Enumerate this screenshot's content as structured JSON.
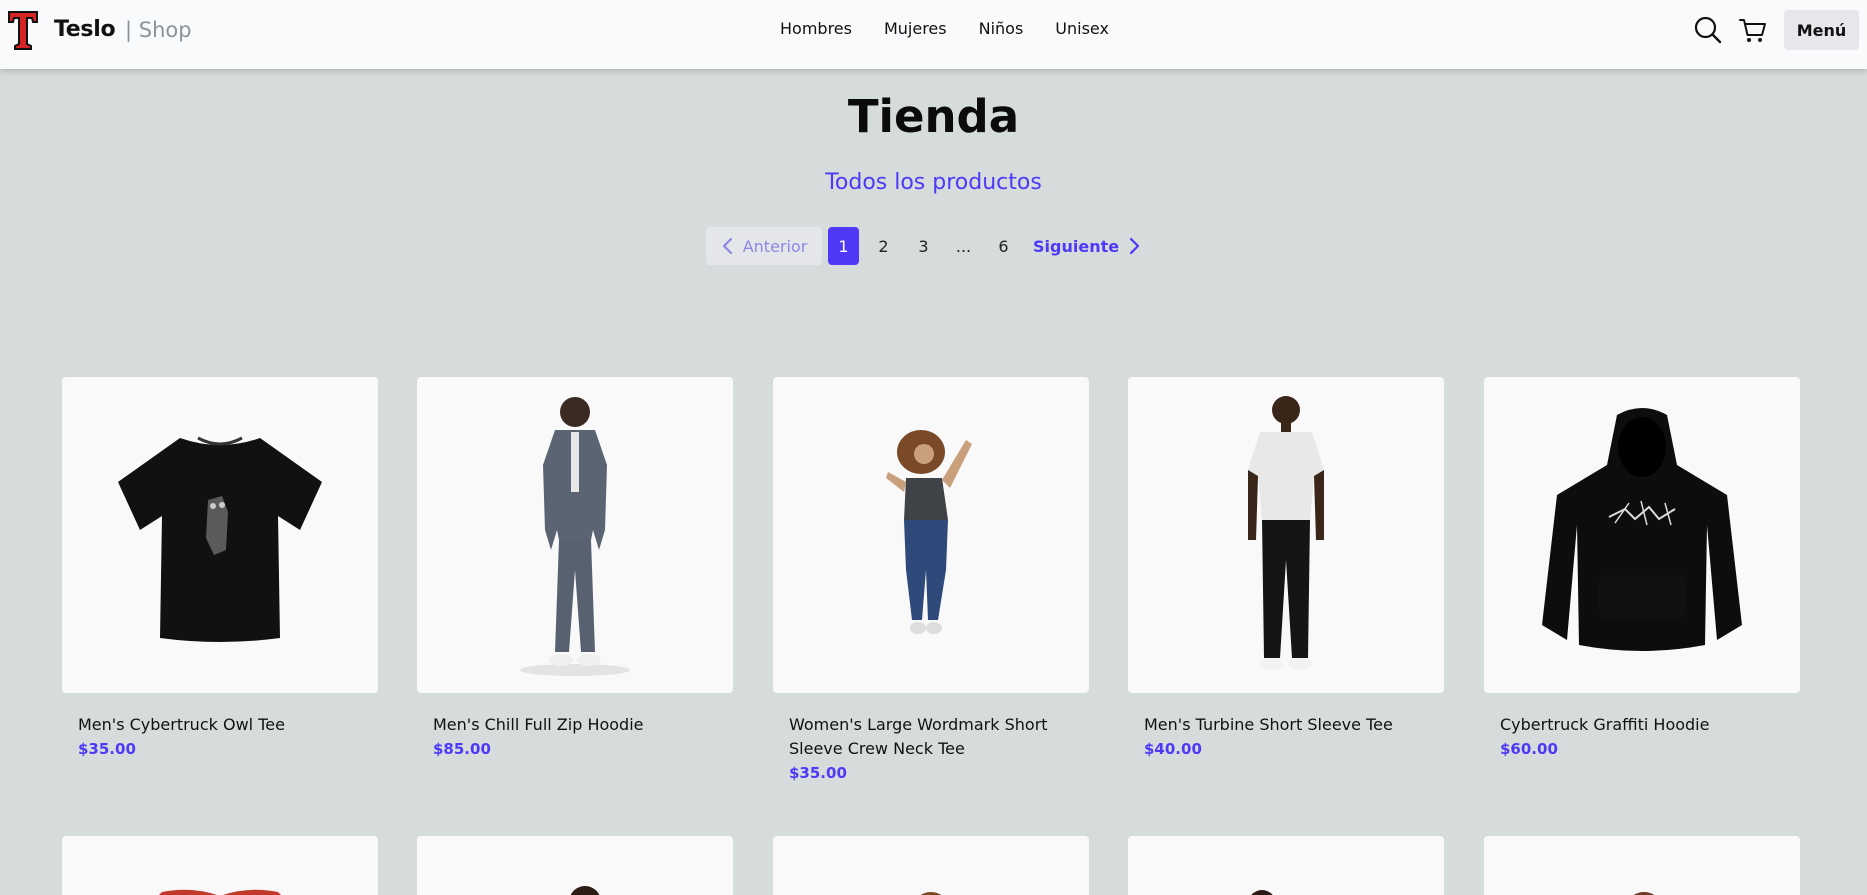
{
  "header": {
    "logo_icon": "teslo-t-logo-icon",
    "brand": "Teslo",
    "brand_suffix": "| Shop",
    "nav": [
      "Hombres",
      "Mujeres",
      "Niños",
      "Unisex"
    ],
    "search_icon": "search-icon",
    "cart_icon": "cart-icon",
    "menu_label": "Menú"
  },
  "page": {
    "title": "Tienda",
    "subtitle": "Todos los productos"
  },
  "pagination": {
    "prev_label": "Anterior",
    "pages": [
      "1",
      "2",
      "3",
      "...",
      "6"
    ],
    "current": "1",
    "next_label": "Siguiente"
  },
  "products": [
    {
      "title": "Men's Cybertruck Owl Tee",
      "price": "$35.00",
      "image": "black-tshirt"
    },
    {
      "title": "Men's Chill Full Zip Hoodie",
      "price": "$85.00",
      "image": "man-gray-hoodie"
    },
    {
      "title": "Women's Large Wordmark Short Sleeve Crew Neck Tee",
      "price": "$35.00",
      "image": "woman-jumping"
    },
    {
      "title": "Men's Turbine Short Sleeve Tee",
      "price": "$40.00",
      "image": "man-white-tee"
    },
    {
      "title": "Cybertruck Graffiti Hoodie",
      "price": "$60.00",
      "image": "black-hoodie"
    }
  ],
  "colors": {
    "accent": "#4f39f6",
    "background": "#d6dbdb",
    "navbar": "#f9fafb"
  }
}
